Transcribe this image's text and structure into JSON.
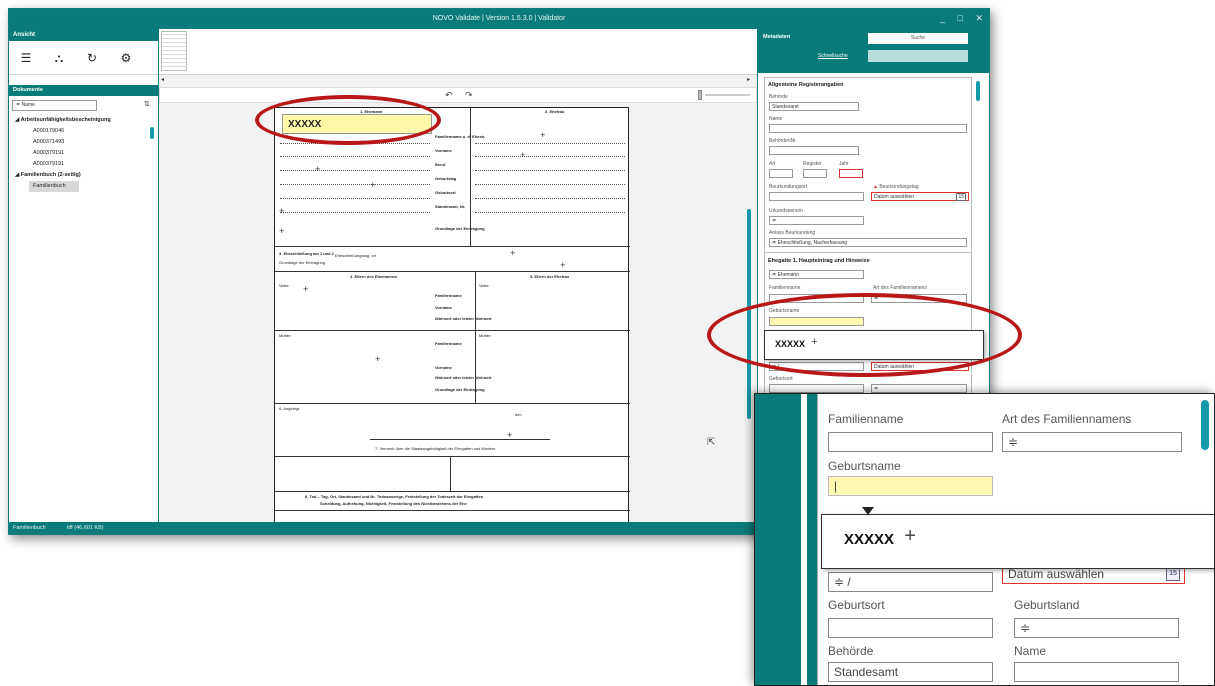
{
  "window": {
    "title": "NOVO Validate | Version 1.5.3.0 | Validator",
    "controls": [
      "_",
      "□",
      "✕"
    ]
  },
  "left_panel": {
    "header": "Ansicht",
    "docs_header": "Dokumente",
    "filter_value": "Name",
    "filter_prefix": "≑",
    "sort_icon": "⇅",
    "tree": [
      {
        "label": "Arbeitsunfähigkeitsbescheinigung",
        "children": [
          "A000179046",
          "A000371493",
          "A000379191",
          "A000379191"
        ]
      },
      {
        "label": "Familienbuch (2-seitig)",
        "children": [
          "Familienbuch"
        ]
      }
    ]
  },
  "viewer": {
    "prev_arrow": "◂",
    "next_arrow": "▸",
    "rotate_left": "↶",
    "rotate_right": "↷",
    "document": {
      "highlight_text": "XXXXX",
      "section_1": "1. Ehemann",
      "section_2": "2. Ehefrau",
      "labels_right": [
        "Familienname u. d. Ehestr.",
        "Vorname",
        "Beruf",
        "Geburtstag",
        "Geburtsort",
        "Standesamt, Nr.",
        "Grundlage der Eintragung"
      ],
      "sec_marriage": "3. Eheschließung am 1 und 2",
      "sec_marriage_sub": "Eheschließungstag, ort",
      "sec_marriage_sub2": "Grundlage der Eintragung",
      "sec_parents_husband": "4. Eltern des Ehemannes",
      "sec_parents_wife": "5. Eltern der Ehefrau",
      "vater": "Vater:",
      "mutter": "Mutter:",
      "parent_labels": [
        "Familienname",
        "Vorname",
        "Wohnort oder letzter Wohnort",
        "Grundlage der Eintragung"
      ],
      "sec_ausgang": "6. Angelegt",
      "den": "den",
      "sec7": "7. Vermerk über die Staatsangehörigkeit der Ehegatten und Kindern",
      "sec8": "8. Tod – Tag, Ort, Standesamt und Nr. Todesanzeige, Feststellung der Todeszeit der Ehegatten",
      "sec8b": "Scheidung, Aufhebung, Nichtigkeit, Feststellung des Nichtbestehens der Ehe"
    }
  },
  "right_panel": {
    "header": "Metadaten",
    "search_placeholder": "Suche",
    "quick_search": "Schnellsuche",
    "sec_general": "Allgemeine Registerangaben",
    "behoerde_label": "Behörde",
    "behoerde_value": "Standesamt",
    "name_label": "Name",
    "behoerde_nr_label": "BehördenNr",
    "art_label": "Art",
    "register_label": "Register",
    "jahr_label": "Jahr",
    "beurkundungsort_label": "Beurkundungsort",
    "beurkundungstag_label": "Beurkundungstag",
    "warn_icon": "▲",
    "datum_placeholder": "Datum auswählen",
    "calendar_icon_text": "15",
    "urkundsperson_label": "Urkundsperson",
    "anlass_label": "Anlass Beurkundung",
    "anlass_value": "Eheschließung, Nacherfassung",
    "sec_spouse": "Ehegatte 1, Haupteintrag und Hinweise",
    "spouse_select": "Ehemann",
    "familienname_label": "Familienname",
    "art_familienname_label": "Art des Familiennamens",
    "geburtsname_label": "Geburtsname",
    "geburtsort_label": "Geburtsort",
    "geburtsland_label": "Geburtsland",
    "behoerde2_label": "Behörde",
    "name2_label": "Name"
  },
  "status_bar": {
    "doc": "Familienbuch",
    "info": "tiff (46,601 KB)"
  },
  "callout_text": "XXXXX",
  "inset": {
    "familienname": "Familienname",
    "art_familienname": "Art des Familiennamens",
    "geburtsname": "Geburtsname",
    "datum_placeholder": "Datum auswählen",
    "calendar": "15",
    "geburtsort": "Geburtsort",
    "geburtsland": "Geburtsland",
    "behoerde": "Behörde",
    "name": "Name",
    "behoerde_value": "Standesamt",
    "select_prefix": "≑",
    "select_value_left": "/"
  },
  "colors": {
    "teal": "#0a7b7b",
    "accent_scroll": "#1599a8",
    "highlight": "#fff8a8",
    "annotation_red": "#b81818",
    "error": "#d33333"
  }
}
